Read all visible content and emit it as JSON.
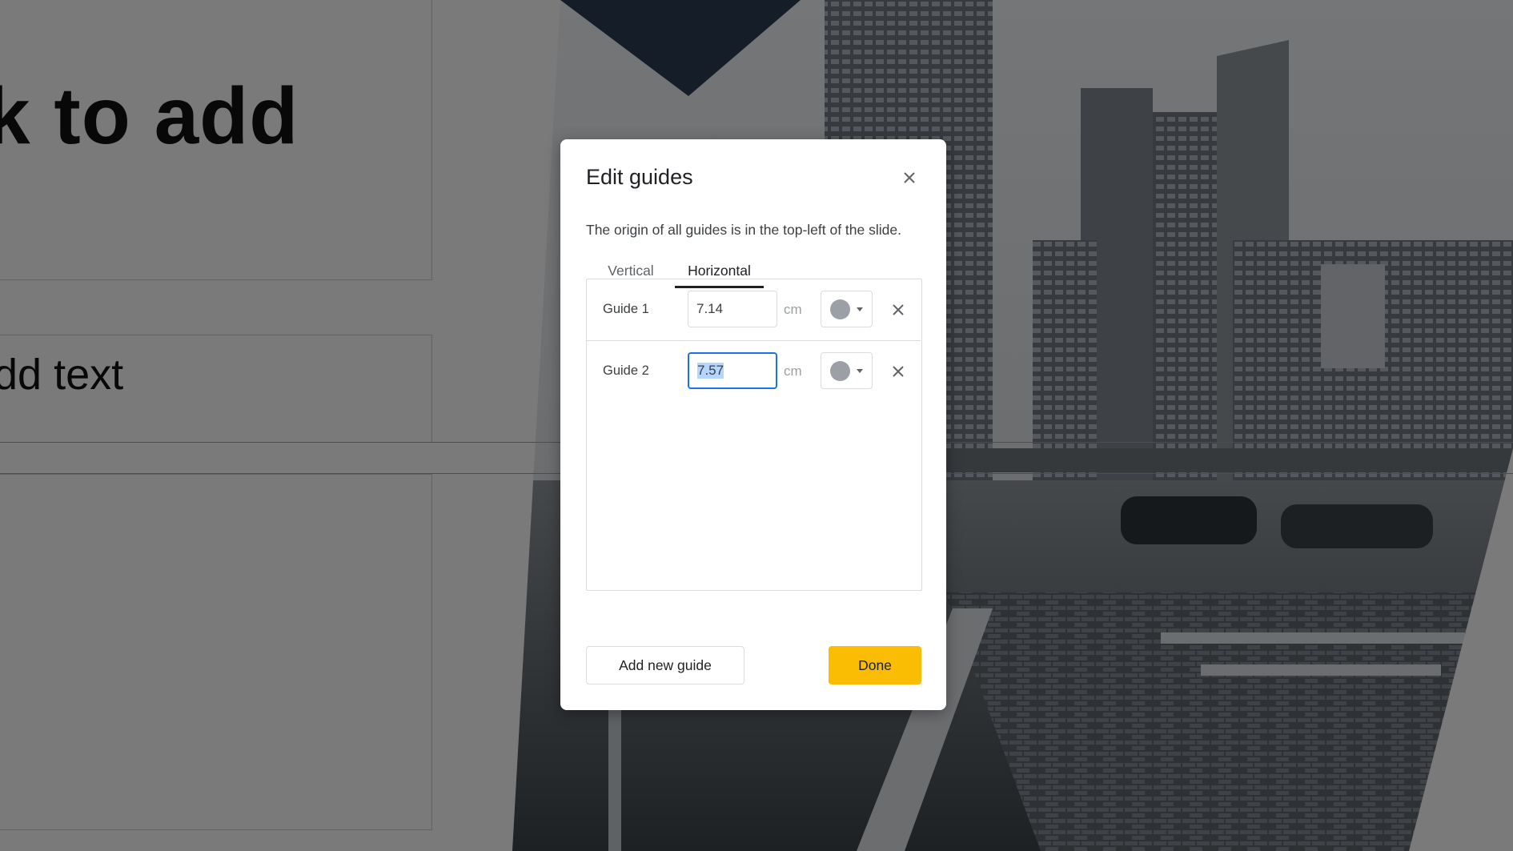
{
  "slide": {
    "title_text": "k to add",
    "body_text": "dd text"
  },
  "dialog": {
    "title": "Edit guides",
    "close_icon": "close-icon",
    "description": "The origin of all guides is in the top-left of the slide.",
    "tabs": [
      {
        "label": "Vertical",
        "active": false
      },
      {
        "label": "Horizontal",
        "active": true
      }
    ],
    "guides": [
      {
        "label": "Guide 1",
        "value": "7.14",
        "unit": "cm",
        "color": "#9aa0a6",
        "focused": false
      },
      {
        "label": "Guide 2",
        "value": "7.57",
        "unit": "cm",
        "color": "#9aa0a6",
        "focused": true
      }
    ],
    "add_button": "Add new guide",
    "done_button": "Done",
    "accent_color": "#fbbc04",
    "focus_color": "#1a73e8"
  }
}
